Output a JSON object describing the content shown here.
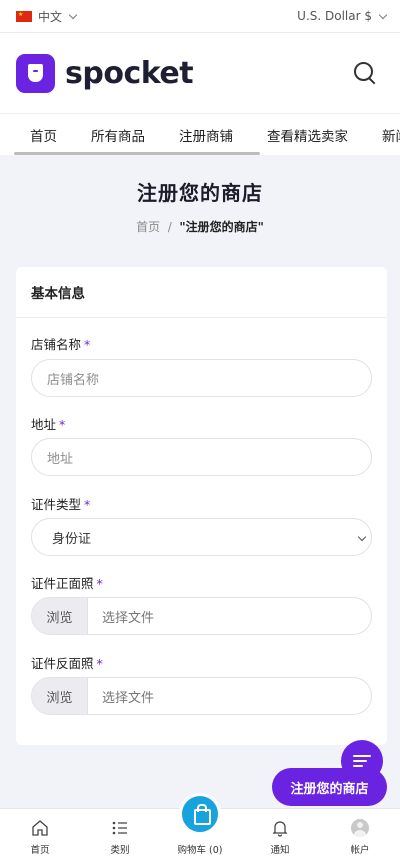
{
  "topbar": {
    "language": "中文",
    "currency": "U.S. Dollar $"
  },
  "header": {
    "logo_text": "spocket"
  },
  "nav": {
    "tabs": [
      "首页",
      "所有商品",
      "注册商铺",
      "查看精选卖家",
      "新闻"
    ]
  },
  "page": {
    "title": "注册您的商店",
    "breadcrumb_home": "首页",
    "breadcrumb_sep": "/",
    "breadcrumb_current": "\"注册您的商店\""
  },
  "form": {
    "section_title": "基本信息",
    "required_mark": "*",
    "shop_name": {
      "label": "店铺名称",
      "placeholder": "店铺名称"
    },
    "address": {
      "label": "地址",
      "placeholder": "地址"
    },
    "id_type": {
      "label": "证件类型",
      "value": "身份证"
    },
    "id_front": {
      "label": "证件正面照",
      "browse": "浏览",
      "file_placeholder": "选择文件"
    },
    "id_back": {
      "label": "证件反面照",
      "browse": "浏览",
      "file_placeholder": "选择文件"
    }
  },
  "cta": {
    "label": "注册您的商店"
  },
  "bottom_nav": [
    {
      "label": "首页",
      "icon": "home-icon"
    },
    {
      "label": "类别",
      "icon": "list-icon"
    },
    {
      "label": "购物车 (0)",
      "icon": "shopping-bag-icon"
    },
    {
      "label": "通知",
      "icon": "bell-icon"
    },
    {
      "label": "帐户",
      "icon": "user-avatar-icon"
    }
  ],
  "colors": {
    "brand": "#6a23e0",
    "cart": "#19a3dc",
    "background": "#f2f3f8"
  }
}
